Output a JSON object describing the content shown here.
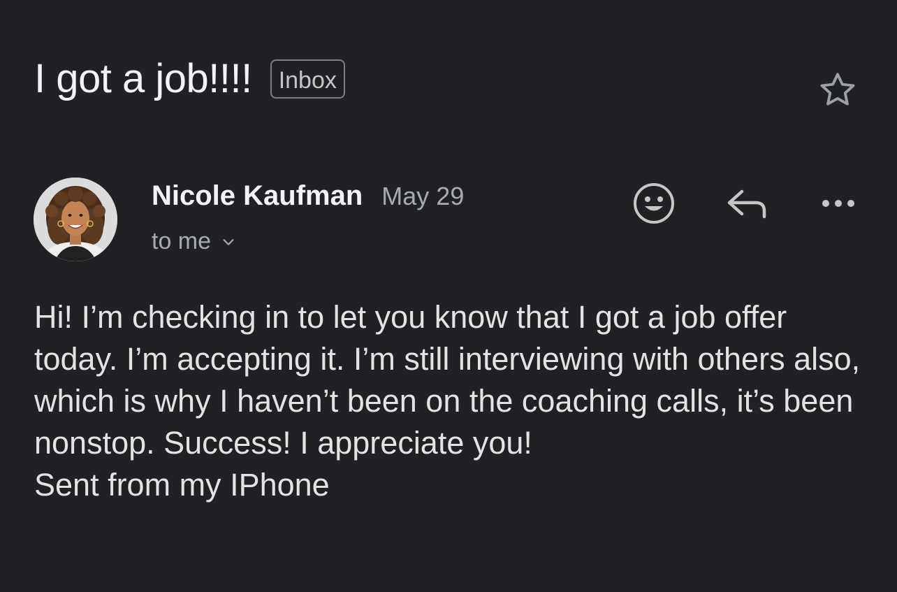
{
  "email": {
    "subject": "I got a job!!!!",
    "label": "Inbox",
    "sender": {
      "name": "Nicole Kaufman",
      "date": "May 29",
      "recipient": "to me"
    },
    "body": "Hi! I’m checking in to let you know that I got a job offer today. I’m accepting it. I’m still interviewing with others also, which is why I haven’t been on the coaching calls, it’s been nonstop. Success! I appreciate you!\nSent from my IPhone"
  },
  "icons": {
    "star": "star-outline-icon",
    "emoji": "smiley-face-icon",
    "reply": "reply-arrow-icon",
    "more": "more-horizontal-icon",
    "expand": "chevron-down-icon"
  },
  "colors": {
    "background": "#202124",
    "text_primary": "#f1f3f4",
    "text_secondary": "#a8abb0",
    "chip_border": "#7c7f84"
  }
}
